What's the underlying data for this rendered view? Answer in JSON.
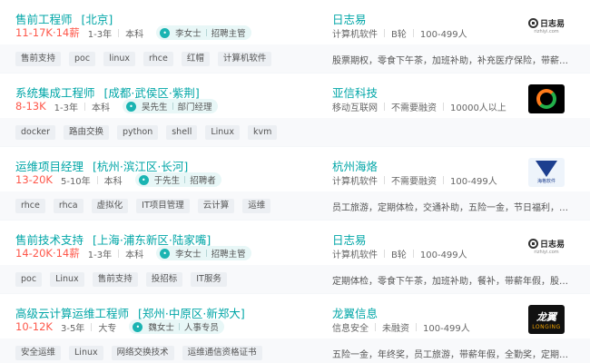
{
  "jobs": [
    {
      "title": "售前工程师",
      "area": "[北京]",
      "salary": "11-17K·14薪",
      "experience": "1-3年",
      "degree": "本科",
      "recruiter_name": "李女士",
      "recruiter_title": "招聘主管",
      "company": "日志易",
      "industry": "计算机软件",
      "stage": "B轮",
      "size": "100-499人",
      "logo": "rizhiyi",
      "logo_text": "日志易",
      "logo_sub": "rizhiyi.com",
      "tags": [
        "售前支持",
        "poc",
        "linux",
        "rhce",
        "红帽",
        "计算机软件"
      ],
      "welfare": "股票期权，零食下午茶，加班补助，补充医疗保险，带薪…"
    },
    {
      "title": "系统集成工程师",
      "area": "[成都·武侯区·紫荆]",
      "salary": "8-13K",
      "experience": "1-3年",
      "degree": "本科",
      "recruiter_name": "吴先生",
      "recruiter_title": "部门经理",
      "company": "亚信科技",
      "industry": "移动互联网",
      "stage": "不需要融资",
      "size": "10000人以上",
      "logo": "yaxin",
      "tags": [
        "docker",
        "路由交换",
        "python",
        "shell",
        "Linux",
        "kvm"
      ],
      "welfare": ""
    },
    {
      "title": "运维项目经理",
      "area": "[杭州·滨江区·长河]",
      "salary": "13-20K",
      "experience": "5-10年",
      "degree": "本科",
      "recruiter_name": "于先生",
      "recruiter_title": "招聘者",
      "company": "杭州海烙",
      "industry": "计算机软件",
      "stage": "不需要融资",
      "size": "100-499人",
      "logo": "haige",
      "logo_sub": "海格软件",
      "tags": [
        "rhce",
        "rhca",
        "虚拟化",
        "IT项目管理",
        "云计算",
        "运维"
      ],
      "welfare": "员工旅游，定期体检，交通补助，五险一金，节日福利，…"
    },
    {
      "title": "售前技术支持",
      "area": "[上海·浦东新区·陆家嘴]",
      "salary": "14-20K·14薪",
      "experience": "1-3年",
      "degree": "本科",
      "recruiter_name": "李女士",
      "recruiter_title": "招聘主管",
      "company": "日志易",
      "industry": "计算机软件",
      "stage": "B轮",
      "size": "100-499人",
      "logo": "rizhiyi",
      "logo_text": "日志易",
      "logo_sub": "rizhiyi.com",
      "tags": [
        "poc",
        "Linux",
        "售前支持",
        "投招标",
        "IT服务"
      ],
      "welfare": "定期体检，零食下午茶，加班补助，餐补，带薪年假，股…"
    },
    {
      "title": "高级云计算运维工程师",
      "area": "[郑州·中原区·新郑大]",
      "salary": "10-12K",
      "experience": "3-5年",
      "degree": "大专",
      "recruiter_name": "魏女士",
      "recruiter_title": "人事专员",
      "company": "龙翼信息",
      "industry": "信息安全",
      "stage": "未融资",
      "size": "100-499人",
      "logo": "longyi",
      "logo_cn": "龙翼",
      "logo_en": "LONGING",
      "tags": [
        "安全运维",
        "Linux",
        "网络交换技术",
        "运维通信资格证书"
      ],
      "welfare": "五险一金，年终奖，员工旅游，带薪年假，全勤奖，定期…"
    }
  ]
}
